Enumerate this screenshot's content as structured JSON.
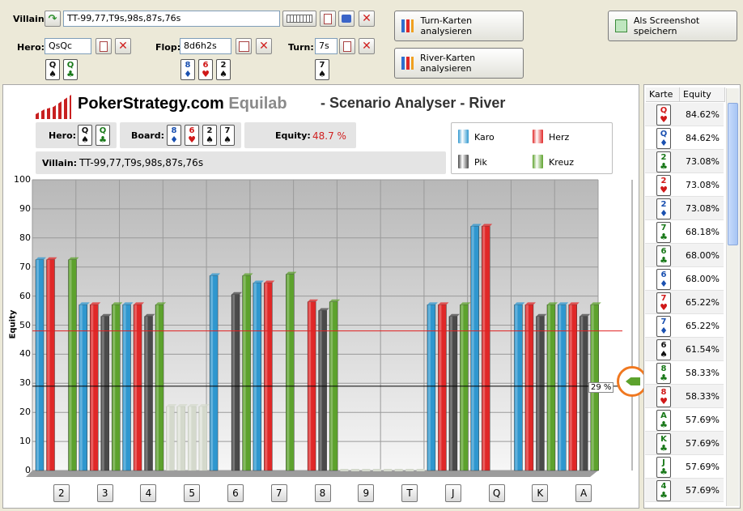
{
  "controls": {
    "villain_label": "Villain:",
    "villain_range": "TT-99,77,T9s,98s,87s,76s",
    "hero_label": "Hero:",
    "hero_hand": "QsQc",
    "flop_label": "Flop:",
    "flop_cards": "8d6h2s",
    "turn_label": "Turn:",
    "turn_card": "7s",
    "turn_analyze_label": "Turn-Karten analysieren",
    "river_analyze_label": "River-Karten analysieren",
    "screenshot_label": "Als Screenshot speichern"
  },
  "cards": {
    "hero": [
      {
        "rank": "Q",
        "suit": "spade"
      },
      {
        "rank": "Q",
        "suit": "club"
      }
    ],
    "flop": [
      {
        "rank": "8",
        "suit": "diamond"
      },
      {
        "rank": "6",
        "suit": "heart"
      },
      {
        "rank": "2",
        "suit": "spade"
      }
    ],
    "turn": [
      {
        "rank": "7",
        "suit": "spade"
      }
    ]
  },
  "panel": {
    "brand": "PokerStrategy.com",
    "brand_product": "Equilab",
    "subtitle": "- Scenario Analyser - River",
    "hero_label": "Hero:",
    "board_label": "Board:",
    "equity_label": "Equity:",
    "equity_value": "48.7 %",
    "villain_label": "Villain:",
    "villain_range": "TT-99,77,T9s,98s,87s,76s",
    "threshold_label": "29 %"
  },
  "legend": [
    {
      "name": "Karo",
      "color": "#2f97cf"
    },
    {
      "name": "Herz",
      "color": "#e02828"
    },
    {
      "name": "Pik",
      "color": "#4a4a4a"
    },
    {
      "name": "Kreuz",
      "color": "#5da22d"
    }
  ],
  "colors": {
    "karo": "#2f97cf",
    "herz": "#e02828",
    "pik": "#4a4a4a",
    "kreuz": "#5da22d",
    "dead": "#d4d9cc",
    "equity_line": "#e02020",
    "threshold_line": "#000000",
    "accent_ring": "#f07820"
  },
  "chart_data": {
    "type": "bar",
    "ylabel": "Equity",
    "ylim": [
      0,
      100
    ],
    "yticks": [
      0,
      10,
      20,
      30,
      40,
      50,
      60,
      70,
      80,
      90,
      100
    ],
    "categories": [
      "2",
      "3",
      "4",
      "5",
      "6",
      "7",
      "8",
      "9",
      "T",
      "J",
      "Q",
      "K",
      "A"
    ],
    "series": [
      {
        "name": "Karo",
        "values": [
          72.5,
          57,
          57,
          22,
          67,
          64.5,
          null,
          0,
          0,
          57,
          84,
          57,
          57
        ]
      },
      {
        "name": "Herz",
        "values": [
          72.5,
          57,
          57,
          22,
          null,
          64.5,
          58,
          0,
          0,
          57,
          84,
          57,
          57
        ]
      },
      {
        "name": "Pik",
        "values": [
          null,
          53,
          53,
          22,
          60.5,
          null,
          55,
          0,
          0,
          53,
          null,
          53,
          53
        ]
      },
      {
        "name": "Kreuz",
        "values": [
          72.5,
          57,
          57,
          22,
          67,
          67.5,
          58,
          0,
          0,
          57,
          null,
          57,
          57
        ]
      }
    ],
    "dead_categories": [
      "5",
      "9",
      "T"
    ],
    "equity_line": 48,
    "threshold_line": 29
  },
  "sidebar": {
    "col_card": "Karte",
    "col_equity": "Equity",
    "rows": [
      {
        "rank": "Q",
        "suit": "heart",
        "equity": "84.62%"
      },
      {
        "rank": "Q",
        "suit": "diamond",
        "equity": "84.62%"
      },
      {
        "rank": "2",
        "suit": "club",
        "equity": "73.08%"
      },
      {
        "rank": "2",
        "suit": "heart",
        "equity": "73.08%"
      },
      {
        "rank": "2",
        "suit": "diamond",
        "equity": "73.08%"
      },
      {
        "rank": "7",
        "suit": "club",
        "equity": "68.18%"
      },
      {
        "rank": "6",
        "suit": "club",
        "equity": "68.00%"
      },
      {
        "rank": "6",
        "suit": "diamond",
        "equity": "68.00%"
      },
      {
        "rank": "7",
        "suit": "heart",
        "equity": "65.22%"
      },
      {
        "rank": "7",
        "suit": "diamond",
        "equity": "65.22%"
      },
      {
        "rank": "6",
        "suit": "spade",
        "equity": "61.54%"
      },
      {
        "rank": "8",
        "suit": "club",
        "equity": "58.33%"
      },
      {
        "rank": "8",
        "suit": "heart",
        "equity": "58.33%"
      },
      {
        "rank": "A",
        "suit": "club",
        "equity": "57.69%"
      },
      {
        "rank": "K",
        "suit": "club",
        "equity": "57.69%"
      },
      {
        "rank": "J",
        "suit": "club",
        "equity": "57.69%"
      },
      {
        "rank": "4",
        "suit": "club",
        "equity": "57.69%"
      }
    ]
  }
}
